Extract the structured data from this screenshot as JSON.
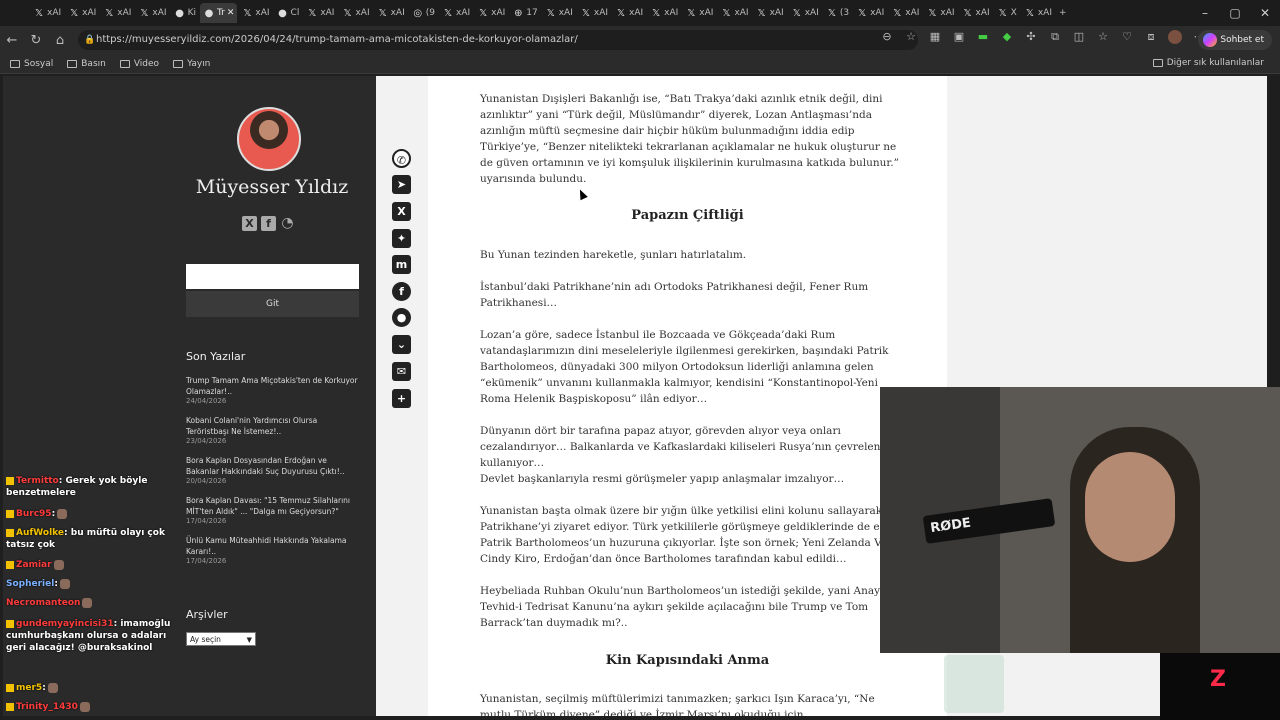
{
  "browser": {
    "tabs": [
      {
        "label": "xAI",
        "icon": "x-icon"
      },
      {
        "label": "xAI",
        "icon": "x-icon"
      },
      {
        "label": "xAI",
        "icon": "x-icon"
      },
      {
        "label": "xAI",
        "icon": "x-icon"
      },
      {
        "label": "Ki",
        "icon": "site-icon"
      },
      {
        "label": "Tr",
        "icon": "site-icon",
        "active": true
      },
      {
        "label": "xAI",
        "icon": "x-icon"
      },
      {
        "label": "Cl",
        "icon": "site-icon"
      },
      {
        "label": "xAI",
        "icon": "x-icon"
      },
      {
        "label": "xAI",
        "icon": "x-icon"
      },
      {
        "label": "xAI",
        "icon": "x-icon"
      },
      {
        "label": "(9",
        "icon": "instagram-icon"
      },
      {
        "label": "xAI",
        "icon": "x-icon"
      },
      {
        "label": "xAI",
        "icon": "x-icon"
      },
      {
        "label": "17",
        "icon": "globe-icon"
      },
      {
        "label": "xAI",
        "icon": "x-icon"
      },
      {
        "label": "xAI",
        "icon": "x-icon"
      },
      {
        "label": "xAI",
        "icon": "x-icon"
      },
      {
        "label": "xAI",
        "icon": "x-icon"
      },
      {
        "label": "xAI",
        "icon": "x-icon"
      },
      {
        "label": "xAI",
        "icon": "x-icon"
      },
      {
        "label": "xAI",
        "icon": "x-icon"
      },
      {
        "label": "xAI",
        "icon": "x-icon"
      },
      {
        "label": "(3",
        "icon": "x-icon"
      },
      {
        "label": "xAI",
        "icon": "x-icon"
      },
      {
        "label": "xAI",
        "icon": "x-icon"
      },
      {
        "label": "xAI",
        "icon": "x-icon"
      },
      {
        "label": "xAI",
        "icon": "x-icon"
      },
      {
        "label": "X",
        "icon": "x-icon"
      },
      {
        "label": "xAI",
        "icon": "x-icon"
      }
    ],
    "url": "https://muyesseryildiz.com/2026/04/24/trump-tamam-ama-micotakisten-de-korkuyor-olamazlar/",
    "copilot_label": "Sohbet et",
    "bookmarks": [
      "Sosyal",
      "Basın",
      "Video",
      "Yayın"
    ],
    "bookmarks_right": "Diğer sık kullanılanlar"
  },
  "sidebar": {
    "site_name": "Müyesser Yıldız",
    "search_button": "Git",
    "recent_title": "Son Yazılar",
    "posts": [
      {
        "title": "Trump Tamam Ama Miçotakis'ten de Korkuyor Olamazlar!..",
        "date": "24/04/2026"
      },
      {
        "title": "Kobani Colani'nin Yardımcısı Olursa Teröristbaşı Ne İstemez!..",
        "date": "23/04/2026"
      },
      {
        "title": "Bora Kaplan Dosyasından Erdoğan ve Bakanlar Hakkındaki Suç Duyurusu Çıktı!..",
        "date": "20/04/2026"
      },
      {
        "title": "Bora Kaplan Davası: \"15 Temmuz Silahlarını MİT'ten Aldık\" ... \"Dalga mı Geçiyorsun?\"",
        "date": "17/04/2026"
      },
      {
        "title": "Ünlü Kamu Müteahhidi Hakkında Yakalama Kararı!..",
        "date": "17/04/2026"
      }
    ],
    "archive_title": "Arşivler",
    "archive_select": "Ay seçin"
  },
  "share_icons": [
    "whatsapp-icon",
    "telegram-icon",
    "x-share-icon",
    "bluesky-icon",
    "mastodon-icon",
    "facebook-icon",
    "reddit-icon",
    "pocket-icon",
    "email-icon",
    "add-share-icon"
  ],
  "article": {
    "p1": "Yunanistan Dışişleri Bakanlığı ise, “Batı Trakya’daki azınlık etnik değil, dini azınlıktır” yani “Türk değil, Müslümandır” diyerek, Lozan Antlaşması’nda azınlığın müftü seçmesine dair hiçbir hüküm bulunmadığını iddia edip Türkiye’ye, “Benzer nitelikteki tekrarlanan açıklamalar ne hukuk oluşturur ne de güven ortamının ve iyi komşuluk ilişkilerinin kurulmasına katkıda bulunur.” uyarısında bulundu.",
    "h1": "Papazın Çiftliği",
    "p2": "Bu Yunan tezinden hareketle, şunları hatırlatalım.",
    "p3": "İstanbul’daki Patrikhane’nin adı Ortodoks Patrikhanesi değil, Fener Rum Patrikhanesi…",
    "p4": "Lozan’a göre, sadece İstanbul ile Bozcaada ve Gökçeada’daki Rum vatandaşlarımızın dini meseleleriyle ilgilenmesi gerekirken, başındaki Patrik Bartholomeos, dünyadaki 300 milyon Ortodoksun liderliği anlamına gelen “ekümenik” unvanını kullanmakla kalmıyor, kendisini “Konstantinopol-Yeni Roma Helenik Başpiskoposu” ilân ediyor…",
    "p5": "Dünyanın dört bir tarafına papaz atıyor, görevden alıyor veya onları cezalandırıyor… Balkanlarda ve Kafkaslardaki kiliseleri Rusya’nın çevrelenmesinde kullanıyor…",
    "p6": "Devlet başkanlarıyla resmi görüşmeler yapıp anlaşmalar imzalıyor…",
    "p7": "Yunanistan başta olmak üzere bir yığın ülke yetkilisi elini kolunu sallayarak Patrikhane’yi ziyaret ediyor. Türk yetkililerle görüşmeye geldiklerinde de en önce Patrik Bartholomeos’un huzuruna çıkıyorlar. İşte son örnek; Yeni Zelanda Valisi Cindy Kiro, Erdoğan’dan önce Bartholomes tarafından kabul edildi…",
    "p8": "Heybeliada Ruhban Okulu’nun Bartholomeos’un istediği şekilde, yani Anayasa ve Tevhid-i Tedrisat Kanunu’na aykırı şekilde açılacağını bile Trump ve Tom Barrack’tan duymadık mı?..",
    "h2": "Kin Kapısındaki Anma",
    "p9": "Yunanistan, seçilmiş müftülerimizi tanımazken; şarkıcı Işın Karaca’yı, “Ne mutlu Türküm diyene” dediği ve İzmir Marşı’nı okuduğu için cezalandırırken…"
  },
  "chat": [
    {
      "user": "Termitto",
      "text": ": Gerek yok böyle benzetmelere",
      "color": "#ff3b3b"
    },
    {
      "user": "Burc95",
      "text": ":",
      "color": "#ff3b3b"
    },
    {
      "user": "AufWolke",
      "text": ": bu müftü olayı çok tatsız çok",
      "color": "#f2c200"
    },
    {
      "user": "Zamiar",
      "text": "",
      "color": "#ff3b3b"
    },
    {
      "user": "Sopheriel",
      "text": ":",
      "color": "#7ab0ff"
    },
    {
      "user": "Necromanteon",
      "text": "",
      "color": "#ff3b3b"
    },
    {
      "user": "gundemyayincisi31",
      "text": ": imamoğlu cumhurbaşkanı olursa o adaları geri alacağız! @buraksakinol",
      "color": "#ff3b3b"
    },
    {
      "user": "mer5",
      "text": ":",
      "color": "#f2c200"
    },
    {
      "user": "Trinity_1430",
      "text": "",
      "color": "#ff3b3b"
    }
  ],
  "webcam": {
    "mic_label": "RØDE"
  },
  "colors": {
    "sidebar_bg": "#2a2a2a",
    "page_bg": "#ffffff",
    "accent_logo": "#ff2a4a"
  }
}
